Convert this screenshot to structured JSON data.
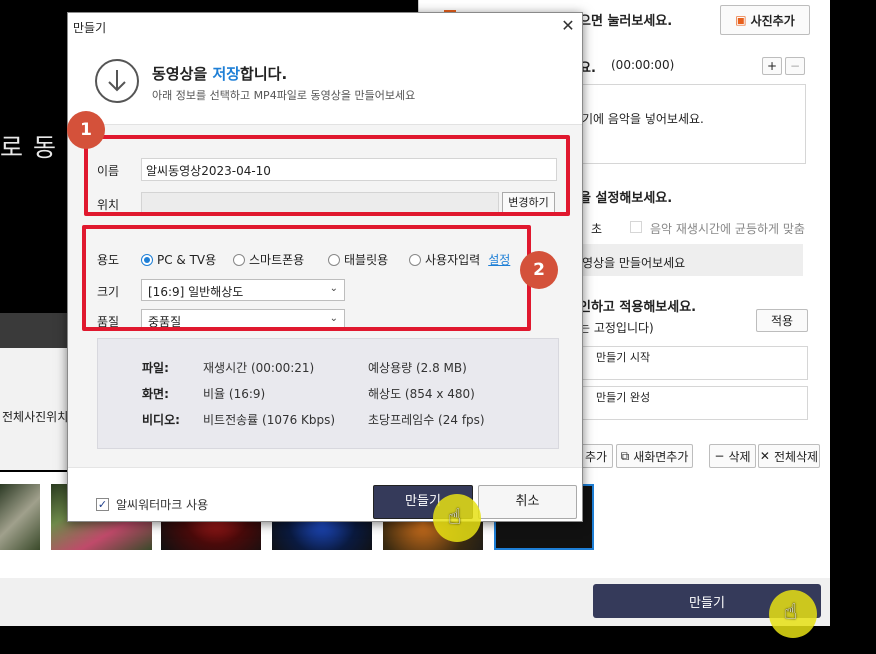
{
  "background_app": {
    "left_text": "로 동",
    "left_panel_text": "전체사진위치",
    "bottom_make_label": "만들기",
    "right_panel": {
      "line1": "으면 눌러보세요.",
      "add_photo_label": "사진추가",
      "music_title": "요.",
      "music_time": "(00:00:00)",
      "music_hint": "기에 음악을 넣어보세요.",
      "time_title": "을 설정해보세요.",
      "seconds_label": "초",
      "sync_label": "음악 재생시간에 균등하게 맞춤",
      "make_hint": "영상을 만들어보세요",
      "apply_title": "인하고 적용해보세요.",
      "fixed_note": "는 고정입니다)",
      "apply_label": "적용",
      "start_text": "만들기 시작",
      "done_text": "만들기 완성",
      "add_label": "추가",
      "new_screen_label": "새화면추가",
      "delete_label": "삭제",
      "delete_all_label": "전체삭제"
    }
  },
  "dialog": {
    "title": "만들기",
    "close_glyph": "✕",
    "header_title_prefix": "동영상을 ",
    "header_title_highlight": "저장",
    "header_title_suffix": "합니다.",
    "header_subtitle": "아래 정보를 선택하고 MP4파일로 동영상을 만들어보세요",
    "name_label": "이름",
    "name_value": "알씨동영상2023-04-10",
    "location_label": "위치",
    "location_value": "",
    "change_button": "변경하기",
    "purpose_label": "용도",
    "purpose_options": [
      "PC & TV용",
      "스마트폰용",
      "태블릿용",
      "사용자입력"
    ],
    "purpose_selected": "PC & TV용",
    "settings_link": "설정",
    "size_label": "크기",
    "size_value": "[16:9] 일반해상도",
    "quality_label": "품질",
    "quality_value": "중품질",
    "info": {
      "file_key": "파일:",
      "file_value1": "재생시간 (00:00:21)",
      "file_value2": "예상용량 (2.8 MB)",
      "screen_key": "화면:",
      "screen_value1": "비율 (16:9)",
      "screen_value2": "해상도 (854 x 480)",
      "video_key": "비디오:",
      "video_value1": "비트전송률 (1076 Kbps)",
      "video_value2": "초당프레임수 (24 fps)"
    },
    "watermark_label": "알씨워터마크 사용",
    "watermark_checked": true,
    "make_button": "만들기",
    "cancel_button": "취소"
  },
  "annotations": {
    "badge1": "1",
    "badge2": "2",
    "highlight_color": "#e0182e"
  },
  "colors": {
    "accent": "#1e7fd6",
    "primary_button": "#353a5a"
  }
}
